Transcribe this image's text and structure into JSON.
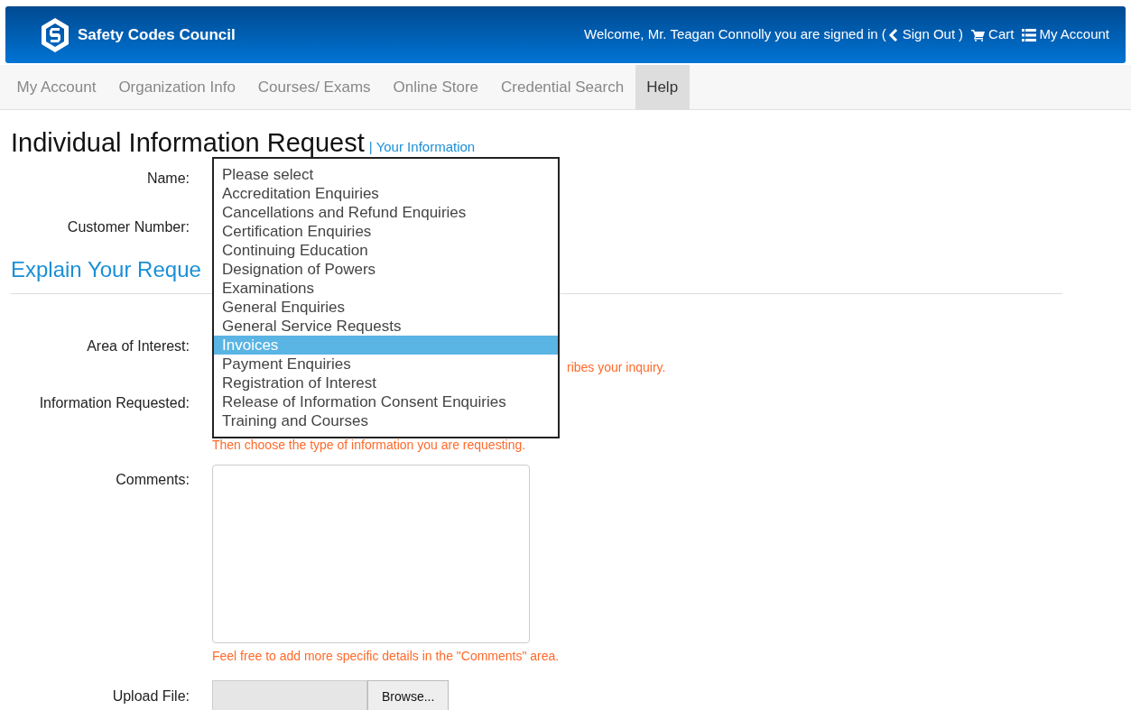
{
  "header": {
    "logo_text": "Safety Codes Council",
    "welcome": "Welcome, Mr. Teagan Connolly you are signed in (",
    "sign_out": "Sign Out",
    "close_paren": ")",
    "cart": "Cart",
    "my_account": "My Account"
  },
  "nav": [
    {
      "label": "My Account",
      "selected": false
    },
    {
      "label": "Organization Info",
      "selected": false
    },
    {
      "label": "Courses/ Exams",
      "selected": false
    },
    {
      "label": "Online Store",
      "selected": false
    },
    {
      "label": "Credential Search",
      "selected": false
    },
    {
      "label": "Help",
      "selected": true
    }
  ],
  "title": "Individual Information Request",
  "title_separator": "|",
  "title_link": "Your Information",
  "form": {
    "name_label": "Name:",
    "customer_number_label": "Customer Number:",
    "section_heading": "Explain Your Reque",
    "area_label": "Area of Interest:",
    "area_hint": "ribes your inquiry.",
    "info_label": "Information Requested:",
    "info_hint": "Then choose the type of information you are requesting.",
    "comments_label": "Comments:",
    "comments_hint": "Feel free to add more specific details in the \"Comments\" area.",
    "upload_label": "Upload File:",
    "browse_button": "Browse..."
  },
  "dropdown": {
    "options": [
      {
        "label": "Please select",
        "selected": false
      },
      {
        "label": "Accreditation Enquiries",
        "selected": false
      },
      {
        "label": "Cancellations and Refund Enquiries",
        "selected": false
      },
      {
        "label": "Certification Enquiries",
        "selected": false
      },
      {
        "label": "Continuing Education",
        "selected": false
      },
      {
        "label": "Designation of Powers",
        "selected": false
      },
      {
        "label": "Examinations",
        "selected": false
      },
      {
        "label": "General Enquiries",
        "selected": false
      },
      {
        "label": "General Service Requests",
        "selected": false
      },
      {
        "label": "Invoices",
        "selected": true
      },
      {
        "label": "Payment Enquiries",
        "selected": false
      },
      {
        "label": "Registration of Interest",
        "selected": false
      },
      {
        "label": "Release of Information Consent Enquiries",
        "selected": false
      },
      {
        "label": "Training and Courses",
        "selected": false
      }
    ]
  }
}
